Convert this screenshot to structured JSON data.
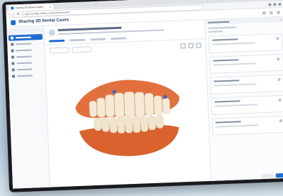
{
  "browser": {
    "tab_title": "Sharing 3D Dental Cases",
    "tab_close": "×",
    "window_controls": [
      "—",
      "□",
      "×"
    ],
    "nav": {
      "back": "‹",
      "forward": "›",
      "reload": "↻"
    },
    "url": "app.example-dental.com/case/3d-model"
  },
  "app": {
    "title": "Sharing 3D Dental Cases"
  },
  "viewer": {
    "description_colors": {
      "gum": "#e2703f",
      "tooth": "#f4ead6",
      "accent": "#1f6fd1"
    }
  }
}
